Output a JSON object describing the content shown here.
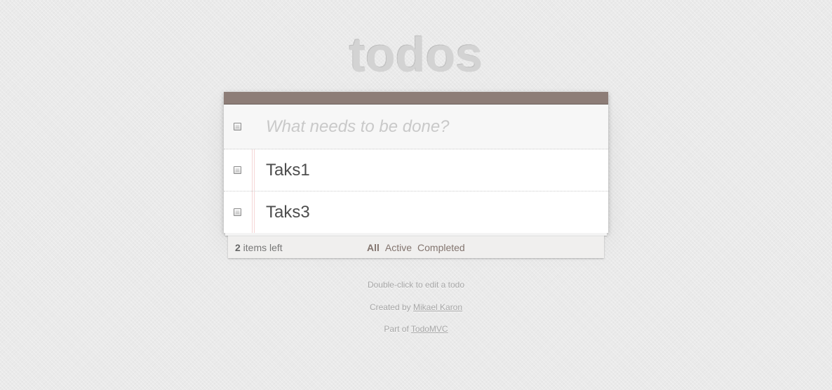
{
  "app": {
    "title": "todos"
  },
  "new_todo": {
    "placeholder": "What needs to be done?",
    "value": ""
  },
  "todos": [
    {
      "label": "Taks1",
      "completed": false
    },
    {
      "label": "Taks3",
      "completed": false
    }
  ],
  "footer": {
    "count": "2",
    "count_suffix": " items left",
    "filters": [
      {
        "label": "All",
        "selected": true
      },
      {
        "label": "Active",
        "selected": false
      },
      {
        "label": "Completed",
        "selected": false
      }
    ]
  },
  "info": {
    "hint": "Double-click to edit a todo",
    "created_by_prefix": "Created by ",
    "author": "Mikael Karon",
    "part_of_prefix": "Part of ",
    "project": "TodoMVC"
  },
  "colors": {
    "header_bar": "#8d7d77",
    "filter_link": "#83756f",
    "title": "#d3d3d3"
  }
}
